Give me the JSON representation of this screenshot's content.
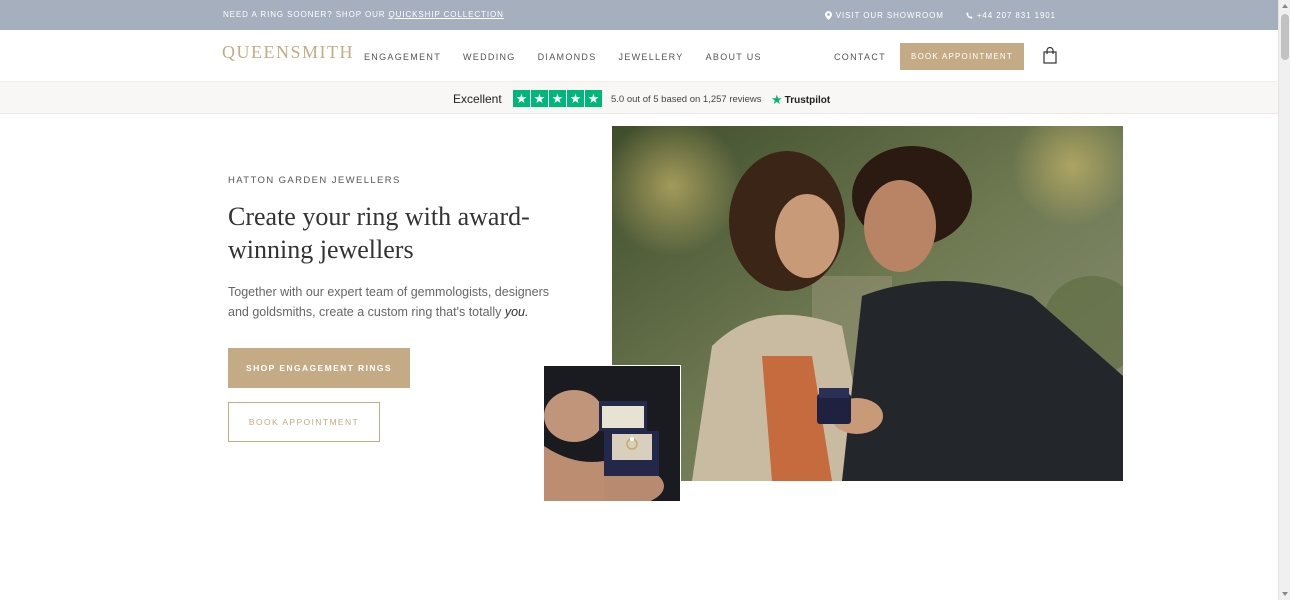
{
  "topbar": {
    "promo_prefix": "NEED A RING SOONER? SHOP OUR ",
    "promo_link": "QUICKSHIP COLLECTION",
    "showroom": "VISIT OUR SHOWROOM",
    "phone": "+44 207 831 1901"
  },
  "nav": {
    "logo": "QUEENSMITH",
    "links": [
      "ENGAGEMENT",
      "WEDDING",
      "DIAMONDS",
      "JEWELLERY",
      "ABOUT US"
    ],
    "contact": "CONTACT",
    "book": "BOOK APPOINTMENT"
  },
  "trustpilot": {
    "label": "Excellent",
    "rating_text": "5.0 out of 5 based on 1,257 reviews",
    "brand": "Trustpilot",
    "stars": 5
  },
  "hero": {
    "eyebrow": "HATTON GARDEN JEWELLERS",
    "headline": "Create your ring with award-winning jewellers",
    "lede": "Together with our expert team of gemmologists, designers and goldsmiths, create a custom ring that's totally ",
    "lede_emphasis": "you.",
    "primary_cta": "SHOP ENGAGEMENT RINGS",
    "secondary_cta": "BOOK APPOINTMENT"
  },
  "colors": {
    "accent": "#c4ab85",
    "topbar": "#a6afbd",
    "trustpilot_green": "#00b67a"
  }
}
